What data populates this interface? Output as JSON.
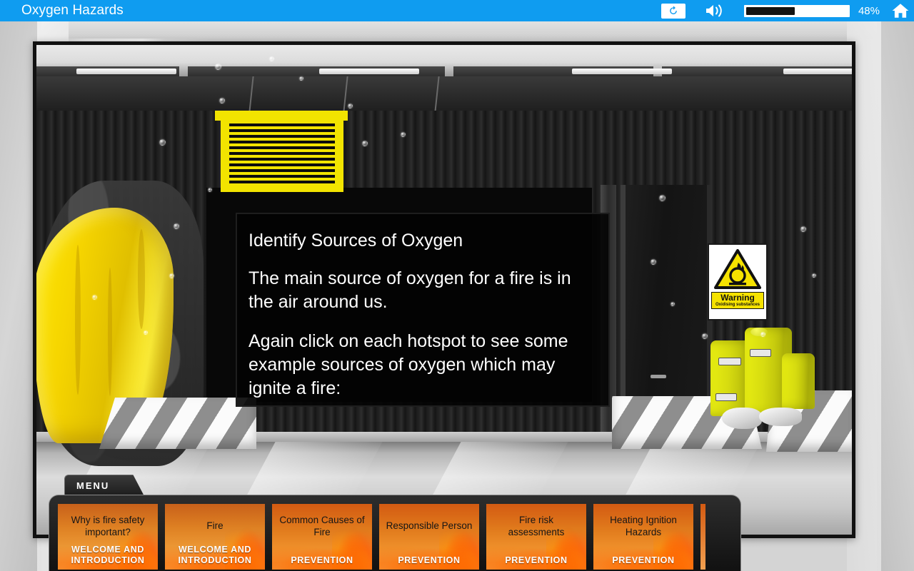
{
  "topbar": {
    "title": "Oxygen Hazards",
    "replay_icon": "replay-icon",
    "volume_icon": "speaker-icon",
    "progress_percent": 48,
    "progress_label": "48%",
    "home_icon": "home-icon",
    "accent_color": "#0f9cf0"
  },
  "slide": {
    "heading": "Identify Sources of Oxygen",
    "paragraph1": "The main source of oxygen for a fire is in the air around us.",
    "paragraph2": "Again click on each hotspot to see some example sources of oxygen which may ignite a fire:"
  },
  "scene": {
    "warning_sign": {
      "title": "Warning",
      "subtitle": "Oxidising substances",
      "sign_color": "#f5e200"
    }
  },
  "menu": {
    "tab_label": "MENU",
    "cards": [
      {
        "title": "Why is fire safety important?",
        "section": "WELCOME AND INTRODUCTION"
      },
      {
        "title": "Fire",
        "section": "WELCOME AND INTRODUCTION"
      },
      {
        "title": "Common Causes of Fire",
        "section": "PREVENTION"
      },
      {
        "title": "Responsible Person",
        "section": "PREVENTION"
      },
      {
        "title": "Fire risk assessments",
        "section": "PREVENTION"
      },
      {
        "title": "Heating Ignition Hazards",
        "section": "PREVENTION"
      }
    ]
  }
}
